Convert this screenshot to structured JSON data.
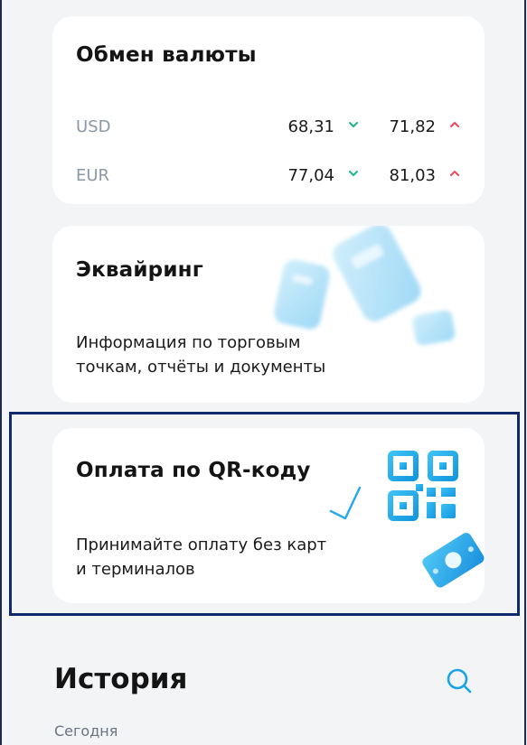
{
  "currency": {
    "title": "Обмен валюты",
    "rows": [
      {
        "code": "USD",
        "buy": "68,31",
        "sell": "71,82"
      },
      {
        "code": "EUR",
        "buy": "77,04",
        "sell": "81,03"
      }
    ]
  },
  "acquiring": {
    "title": "Эквайринг",
    "desc_line1": "Информация по торговым",
    "desc_line2": "точкам, отчёты и документы"
  },
  "qr": {
    "title": "Оплата по QR-коду",
    "desc_line1": "Принимайте оплату без карт",
    "desc_line2": "и терминалов"
  },
  "history": {
    "title": "История",
    "today": "Сегодня"
  },
  "colors": {
    "accent": "#1aa4e4",
    "down": "#1fb38a",
    "up": "#f0465a",
    "frame": "#0e2a6b"
  }
}
